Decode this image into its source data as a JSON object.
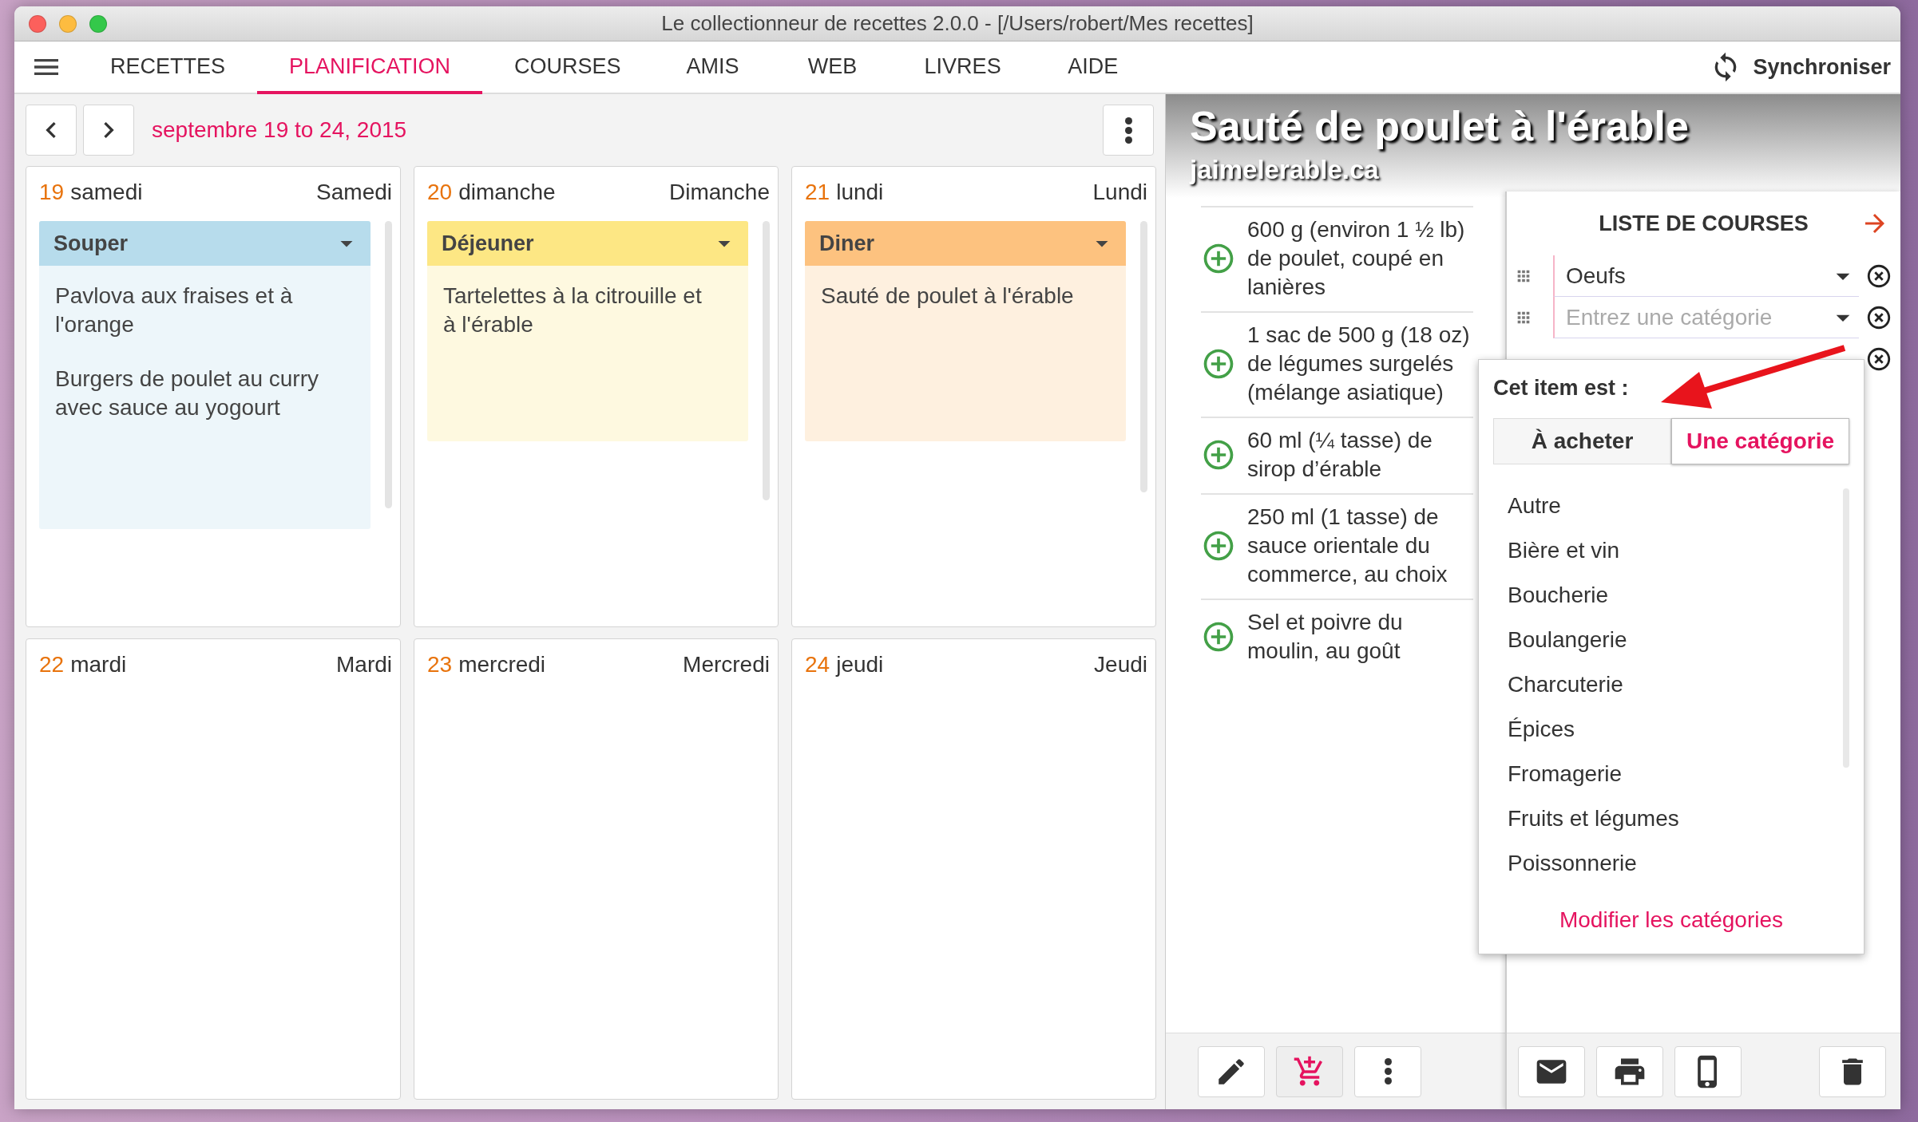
{
  "window": {
    "title": "Le collectionneur de recettes 2.0.0 -  [/Users/robert/Mes recettes]"
  },
  "nav": {
    "tabs": [
      {
        "label": "RECETTES",
        "selected": false
      },
      {
        "label": "PLANIFICATION",
        "selected": true
      },
      {
        "label": "COURSES",
        "selected": false
      },
      {
        "label": "AMIS",
        "selected": false
      },
      {
        "label": "WEB",
        "selected": false
      },
      {
        "label": "LIVRES",
        "selected": false
      },
      {
        "label": "AIDE",
        "selected": false
      }
    ],
    "sync": "Synchroniser"
  },
  "planner": {
    "range": "septembre 19 to 24, 2015",
    "days": [
      {
        "number": "19",
        "day": "samedi",
        "name": "Samedi",
        "meals": [
          {
            "title": "Souper",
            "color": "#b7dcec",
            "recipes": [
              "Pavlova aux fraises et à l'orange",
              "Burgers de poulet au curry avec sauce au yogourt"
            ]
          }
        ]
      },
      {
        "number": "20",
        "day": "dimanche",
        "name": "Dimanche",
        "meals": [
          {
            "title": "Déjeuner",
            "color": "#fde784",
            "recipes": [
              "Tartelettes à la citrouille et à l'érable"
            ]
          }
        ]
      },
      {
        "number": "21",
        "day": "lundi",
        "name": "Lundi",
        "meals": [
          {
            "title": "Diner",
            "color": "#fdc27f",
            "recipes": [
              "Sauté de poulet à l'érable"
            ]
          }
        ]
      },
      {
        "number": "22",
        "day": "mardi",
        "name": "Mardi"
      },
      {
        "number": "23",
        "day": "mercredi",
        "name": "Mercredi"
      },
      {
        "number": "24",
        "day": "jeudi",
        "name": "Jeudi"
      }
    ]
  },
  "recipe": {
    "title": "Sauté de poulet à l'érable",
    "source": "jaimelerable.ca",
    "ingredients": [
      "600 g (environ 1 ½ lb) de poulet, coupé en lanières",
      "1 sac de 500 g (18 oz) de légumes surgelés (mélange asiatique)",
      "60 ml (¼ tasse) de sirop d’érable",
      "250 ml (1 tasse) de sauce orientale du commerce, au choix",
      "Sel et poivre du moulin, au goût"
    ],
    "toolbar": [
      {
        "kind": "edit",
        "active": false
      },
      {
        "kind": "cart",
        "active": true
      },
      {
        "kind": "more",
        "active": false
      }
    ]
  },
  "shopping": {
    "title": "LISTE DE COURSES",
    "items": [
      {
        "value": "Oeufs"
      },
      {
        "placeholder": "Entrez une catégorie"
      },
      {
        "covered": true
      }
    ],
    "toolbar": [
      {
        "kind": "mail"
      },
      {
        "kind": "print"
      },
      {
        "kind": "phone"
      },
      {
        "kind": "trash"
      }
    ]
  },
  "popup": {
    "title": "Cet item est :",
    "options": [
      {
        "label": "À acheter",
        "selected": false
      },
      {
        "label": "Une catégorie",
        "selected": true
      }
    ],
    "categories": [
      "Autre",
      "Bière et vin",
      "Boucherie",
      "Boulangerie",
      "Charcuterie",
      "Épices",
      "Fromagerie",
      "Fruits et légumes",
      "Poissonnerie"
    ],
    "link": "Modifier les catégories"
  }
}
